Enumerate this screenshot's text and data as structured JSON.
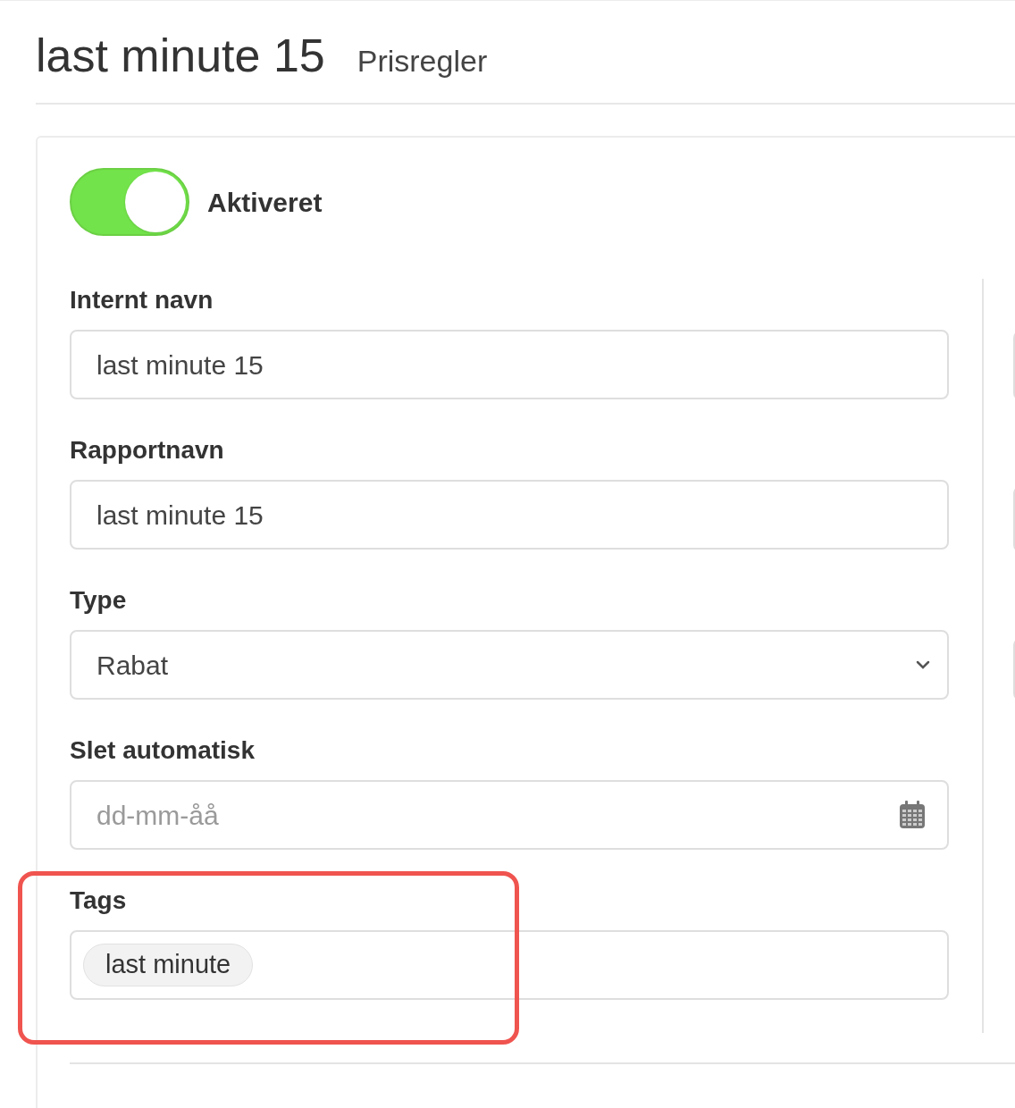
{
  "header": {
    "title": "last minute 15",
    "subtitle": "Prisregler"
  },
  "toggle": {
    "label": "Aktiveret",
    "on": true
  },
  "fields": [
    {
      "kind": "text",
      "label": "Internt navn",
      "value": "last minute 15"
    },
    {
      "kind": "text",
      "label": "Rapportnavn",
      "value": "last minute 15"
    },
    {
      "kind": "select",
      "label": "Type",
      "value": "Rabat"
    },
    {
      "kind": "date",
      "label": "Slet automatisk",
      "placeholder": "dd-mm-åå"
    },
    {
      "kind": "tags",
      "label": "Tags",
      "tags": [
        "last minute"
      ]
    }
  ]
}
